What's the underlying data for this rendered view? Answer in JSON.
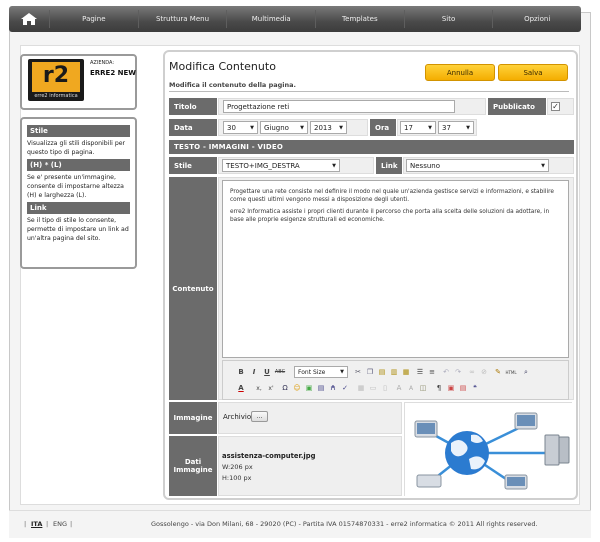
{
  "nav": {
    "items": [
      "Pagine",
      "Struttura Menu",
      "Multimedia",
      "Templates",
      "Sito",
      "Opzioni"
    ]
  },
  "company": {
    "logo_text": "r2",
    "logo_sub": "erre2 informatica",
    "label": "AZIENDA:",
    "value": "ERRE2 NEW"
  },
  "help": [
    {
      "title": "Stile",
      "text": "Visualizza gli stili disponibili per questo tipo di pagina."
    },
    {
      "title": "(H) * (L)",
      "text": "Se e' presente un'immagine, consente di impostarne altezza (H) e larghezza (L)."
    },
    {
      "title": "Link",
      "text": "Se il tipo di stile lo consente, permette di impostare un link ad un'altra pagina del sito."
    }
  ],
  "header": {
    "title": "Modifica Contenuto",
    "subtitle": "Modifica il contenuto della pagina.",
    "cancel_label": "Annulla",
    "save_label": "Salva"
  },
  "form": {
    "title_label": "Titolo",
    "title_value": "Progettazione reti",
    "published_label": "Pubblicato",
    "published_checked": true,
    "date_label": "Data",
    "day": "30",
    "month": "Giugno",
    "year": "2013",
    "time_label": "Ora",
    "hour": "17",
    "minute": "37",
    "section_label": "TESTO - IMMAGINI - VIDEO",
    "style_label": "Stile",
    "style_value": "TESTO+IMG_DESTRA",
    "link_label": "Link",
    "link_value": "Nessuno",
    "content_label": "Contenuto",
    "content_paragraphs": [
      "Progettare una rete consiste nel definire il modo nel quale un'azienda gestisce servizi e informazioni, e stabilire come questi ultimi vengono messi a disposizione degli utenti.",
      "erre2 Informatica assiste i propri clienti durante il percorso che porta alla scelta delle soluzioni da adottare, in base alle proprie esigenze strutturali ed economiche."
    ],
    "image_label": "Immagine",
    "archive_label": "Archivio",
    "archive_button": "...",
    "data_label_1": "Dati",
    "data_label_2": "Immagine",
    "image_file": "assistenza-computer.jpg",
    "image_w": "W:206 px",
    "image_h": "H:100 px"
  },
  "toolbar": {
    "font_size": "Font Size"
  },
  "footer": {
    "lang_ita": "ITA",
    "lang_eng": "ENG",
    "text": "Gossolengo - via Don Milani, 68 - 29020 (PC) - Partita IVA 01574870331 - erre2 informatica © 2011 All rights reserved."
  },
  "colors": {
    "accent": "#f4ad00",
    "label_bg": "#6b6b6b",
    "nav_bg": "#4a4a4a"
  }
}
